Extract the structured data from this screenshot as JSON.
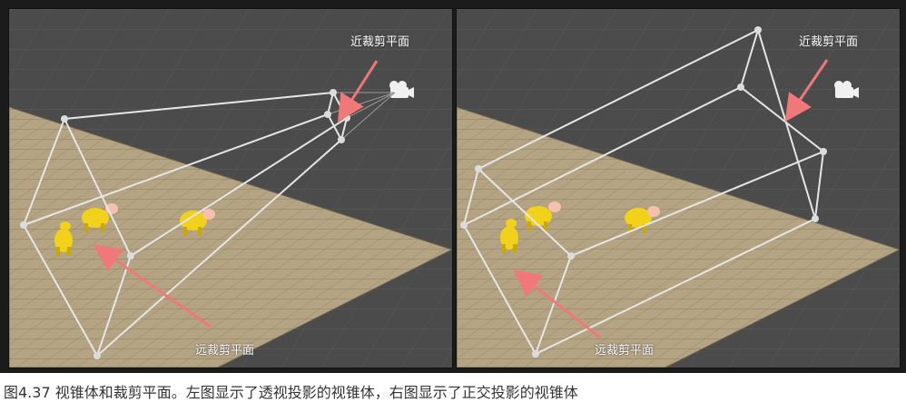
{
  "left_panel": {
    "near_plane_label": "近裁剪平面",
    "far_plane_label": "远裁剪平面"
  },
  "right_panel": {
    "near_plane_label": "近裁剪平面",
    "far_plane_label": "远裁剪平面"
  },
  "caption": "图4.37 视锥体和裁剪平面。左图显示了透视投影的视锥体，右图显示了正交投影的视锥体",
  "colors": {
    "background_grid": "#4b4b4b",
    "floor": "#b4a484",
    "frustum_lines": "#e6e6e6",
    "arrow": "#f07878",
    "cow": "#f2d11a"
  },
  "icons": [
    "camera-icon",
    "cow-figure"
  ]
}
